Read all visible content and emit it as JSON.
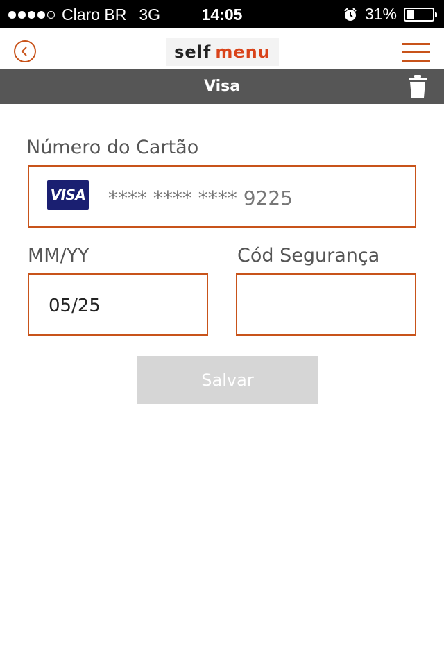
{
  "status_bar": {
    "carrier": "Claro BR",
    "network": "3G",
    "time": "14:05",
    "battery": "31%",
    "battery_level": 0.31,
    "signal_bars": 4
  },
  "nav": {
    "logo_part1": "self",
    "logo_part2": "menu",
    "back_icon": "chevron-left-icon",
    "menu_icon": "hamburger-icon"
  },
  "header": {
    "title": "Visa",
    "delete_icon": "trash-icon"
  },
  "form": {
    "card_number_label": "Número do Cartão",
    "card_brand": "VISA",
    "card_number_value": "**** **** **** 9225",
    "expiry_label": "MM/YY",
    "expiry_value": "05/25",
    "cvv_label": "Cód Segurança",
    "cvv_value": ""
  },
  "actions": {
    "save_label": "Salvar"
  },
  "colors": {
    "accent": "#c8531a",
    "header_bg": "#565656",
    "visa_blue": "#1a1f71",
    "disabled_button": "#d6d6d6"
  }
}
